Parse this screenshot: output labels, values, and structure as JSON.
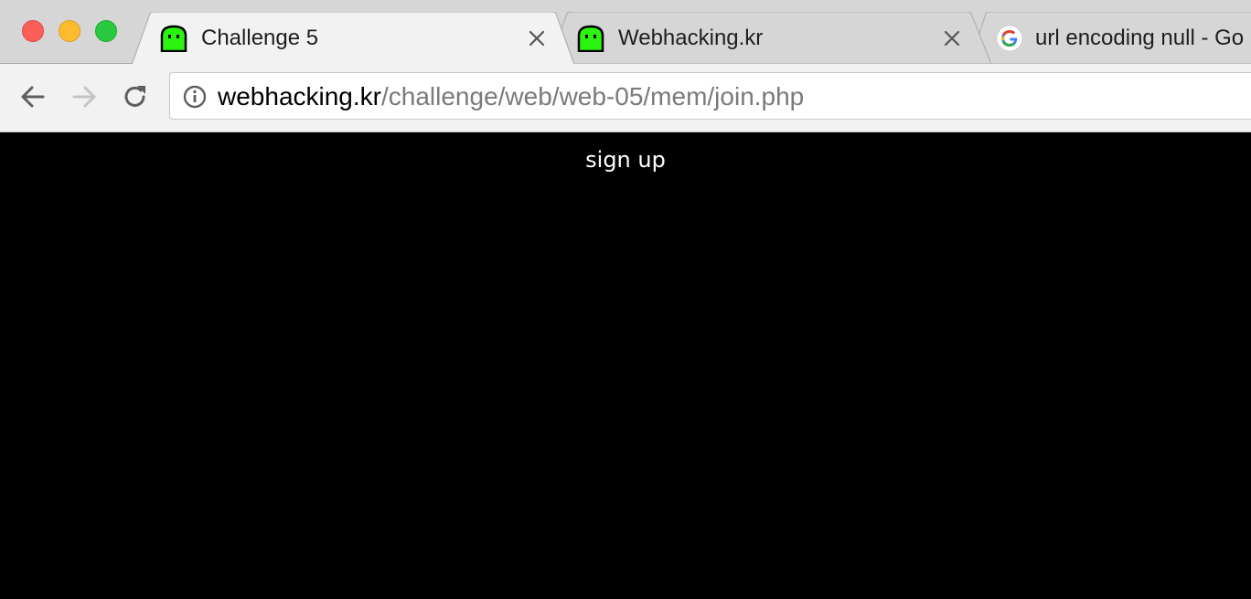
{
  "window": {
    "controls": [
      "close-button",
      "minimize-button",
      "maximize-button"
    ]
  },
  "tabs": [
    {
      "title": "Challenge 5",
      "favicon": "green-ghost-icon",
      "active": true
    },
    {
      "title": "Webhacking.kr",
      "favicon": "green-ghost-icon",
      "active": false
    },
    {
      "title": "url encoding null - Go",
      "favicon": "google-icon",
      "active": false
    }
  ],
  "toolbar": {
    "back": "back-arrow-icon",
    "forward": "forward-arrow-icon",
    "reload": "reload-icon",
    "address": {
      "security_icon": "info-icon",
      "host": "webhacking.kr",
      "path": "/challenge/web/web-05/mem/join.php"
    }
  },
  "page": {
    "heading": "sign up",
    "background": "#000000",
    "text_color": "#ffffff"
  },
  "colors": {
    "favicon_green": "#2bf50f",
    "tab_active": "#f2f2f2",
    "tab_inactive": "#d6d6d6"
  }
}
